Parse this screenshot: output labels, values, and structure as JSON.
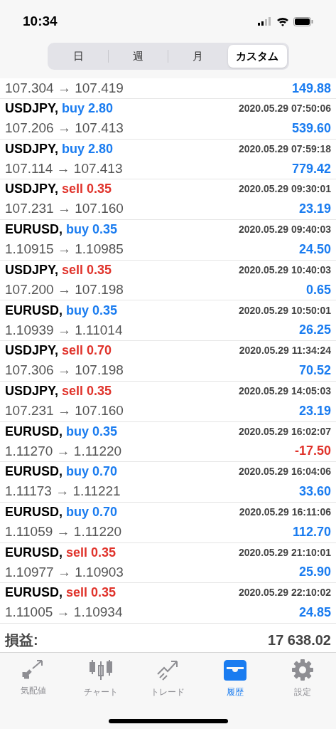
{
  "status_bar": {
    "time": "10:34"
  },
  "period_tabs": [
    {
      "label": "日",
      "selected": false
    },
    {
      "label": "週",
      "selected": false
    },
    {
      "label": "月",
      "selected": false
    },
    {
      "label": "カスタム",
      "selected": true
    }
  ],
  "partial_row": {
    "prices": "107.304 → 107.419",
    "profit": {
      "text": "149.88",
      "kind": "gain"
    }
  },
  "deals": [
    {
      "symbol": "USDJPY,",
      "order": {
        "text": "buy 2.80",
        "kind": "buy"
      },
      "time": "2020.05.29 07:50:06",
      "prices": "107.206 → 107.413",
      "profit": {
        "text": "539.60",
        "kind": "gain"
      }
    },
    {
      "symbol": "USDJPY,",
      "order": {
        "text": "buy 2.80",
        "kind": "buy"
      },
      "time": "2020.05.29 07:59:18",
      "prices": "107.114 → 107.413",
      "profit": {
        "text": "779.42",
        "kind": "gain"
      }
    },
    {
      "symbol": "USDJPY,",
      "order": {
        "text": "sell 0.35",
        "kind": "sell"
      },
      "time": "2020.05.29 09:30:01",
      "prices": "107.231 → 107.160",
      "profit": {
        "text": "23.19",
        "kind": "gain"
      }
    },
    {
      "symbol": "EURUSD,",
      "order": {
        "text": "buy 0.35",
        "kind": "buy"
      },
      "time": "2020.05.29 09:40:03",
      "prices": "1.10915 → 1.10985",
      "profit": {
        "text": "24.50",
        "kind": "gain"
      }
    },
    {
      "symbol": "USDJPY,",
      "order": {
        "text": "sell 0.35",
        "kind": "sell"
      },
      "time": "2020.05.29 10:40:03",
      "prices": "107.200 → 107.198",
      "profit": {
        "text": "0.65",
        "kind": "gain"
      }
    },
    {
      "symbol": "EURUSD,",
      "order": {
        "text": "buy 0.35",
        "kind": "buy"
      },
      "time": "2020.05.29 10:50:01",
      "prices": "1.10939 → 1.11014",
      "profit": {
        "text": "26.25",
        "kind": "gain"
      }
    },
    {
      "symbol": "USDJPY,",
      "order": {
        "text": "sell 0.70",
        "kind": "sell"
      },
      "time": "2020.05.29 11:34:24",
      "prices": "107.306 → 107.198",
      "profit": {
        "text": "70.52",
        "kind": "gain"
      }
    },
    {
      "symbol": "USDJPY,",
      "order": {
        "text": "sell 0.35",
        "kind": "sell"
      },
      "time": "2020.05.29 14:05:03",
      "prices": "107.231 → 107.160",
      "profit": {
        "text": "23.19",
        "kind": "gain"
      }
    },
    {
      "symbol": "EURUSD,",
      "order": {
        "text": "buy 0.35",
        "kind": "buy"
      },
      "time": "2020.05.29 16:02:07",
      "prices": "1.11270 → 1.11220",
      "profit": {
        "text": "-17.50",
        "kind": "loss"
      }
    },
    {
      "symbol": "EURUSD,",
      "order": {
        "text": "buy 0.70",
        "kind": "buy"
      },
      "time": "2020.05.29 16:04:06",
      "prices": "1.11173 → 1.11221",
      "profit": {
        "text": "33.60",
        "kind": "gain"
      }
    },
    {
      "symbol": "EURUSD,",
      "order": {
        "text": "buy 0.70",
        "kind": "buy"
      },
      "time": "2020.05.29 16:11:06",
      "prices": "1.11059 → 1.11220",
      "profit": {
        "text": "112.70",
        "kind": "gain"
      }
    },
    {
      "symbol": "EURUSD,",
      "order": {
        "text": "sell 0.35",
        "kind": "sell"
      },
      "time": "2020.05.29 21:10:01",
      "prices": "1.10977 → 1.10903",
      "profit": {
        "text": "25.90",
        "kind": "gain"
      }
    },
    {
      "symbol": "EURUSD,",
      "order": {
        "text": "sell 0.35",
        "kind": "sell"
      },
      "time": "2020.05.29 22:10:02",
      "prices": "1.11005 → 1.10934",
      "profit": {
        "text": "24.85",
        "kind": "gain"
      }
    }
  ],
  "summary": {
    "label": "損益:",
    "value": "17 638.02"
  },
  "tab_bar": [
    {
      "label": "気配値",
      "kind": "quotes",
      "selected": false
    },
    {
      "label": "チャート",
      "kind": "chart",
      "selected": false
    },
    {
      "label": "トレード",
      "kind": "trade",
      "selected": false
    },
    {
      "label": "履歴",
      "kind": "history",
      "selected": true
    },
    {
      "label": "設定",
      "kind": "settings",
      "selected": false
    }
  ]
}
